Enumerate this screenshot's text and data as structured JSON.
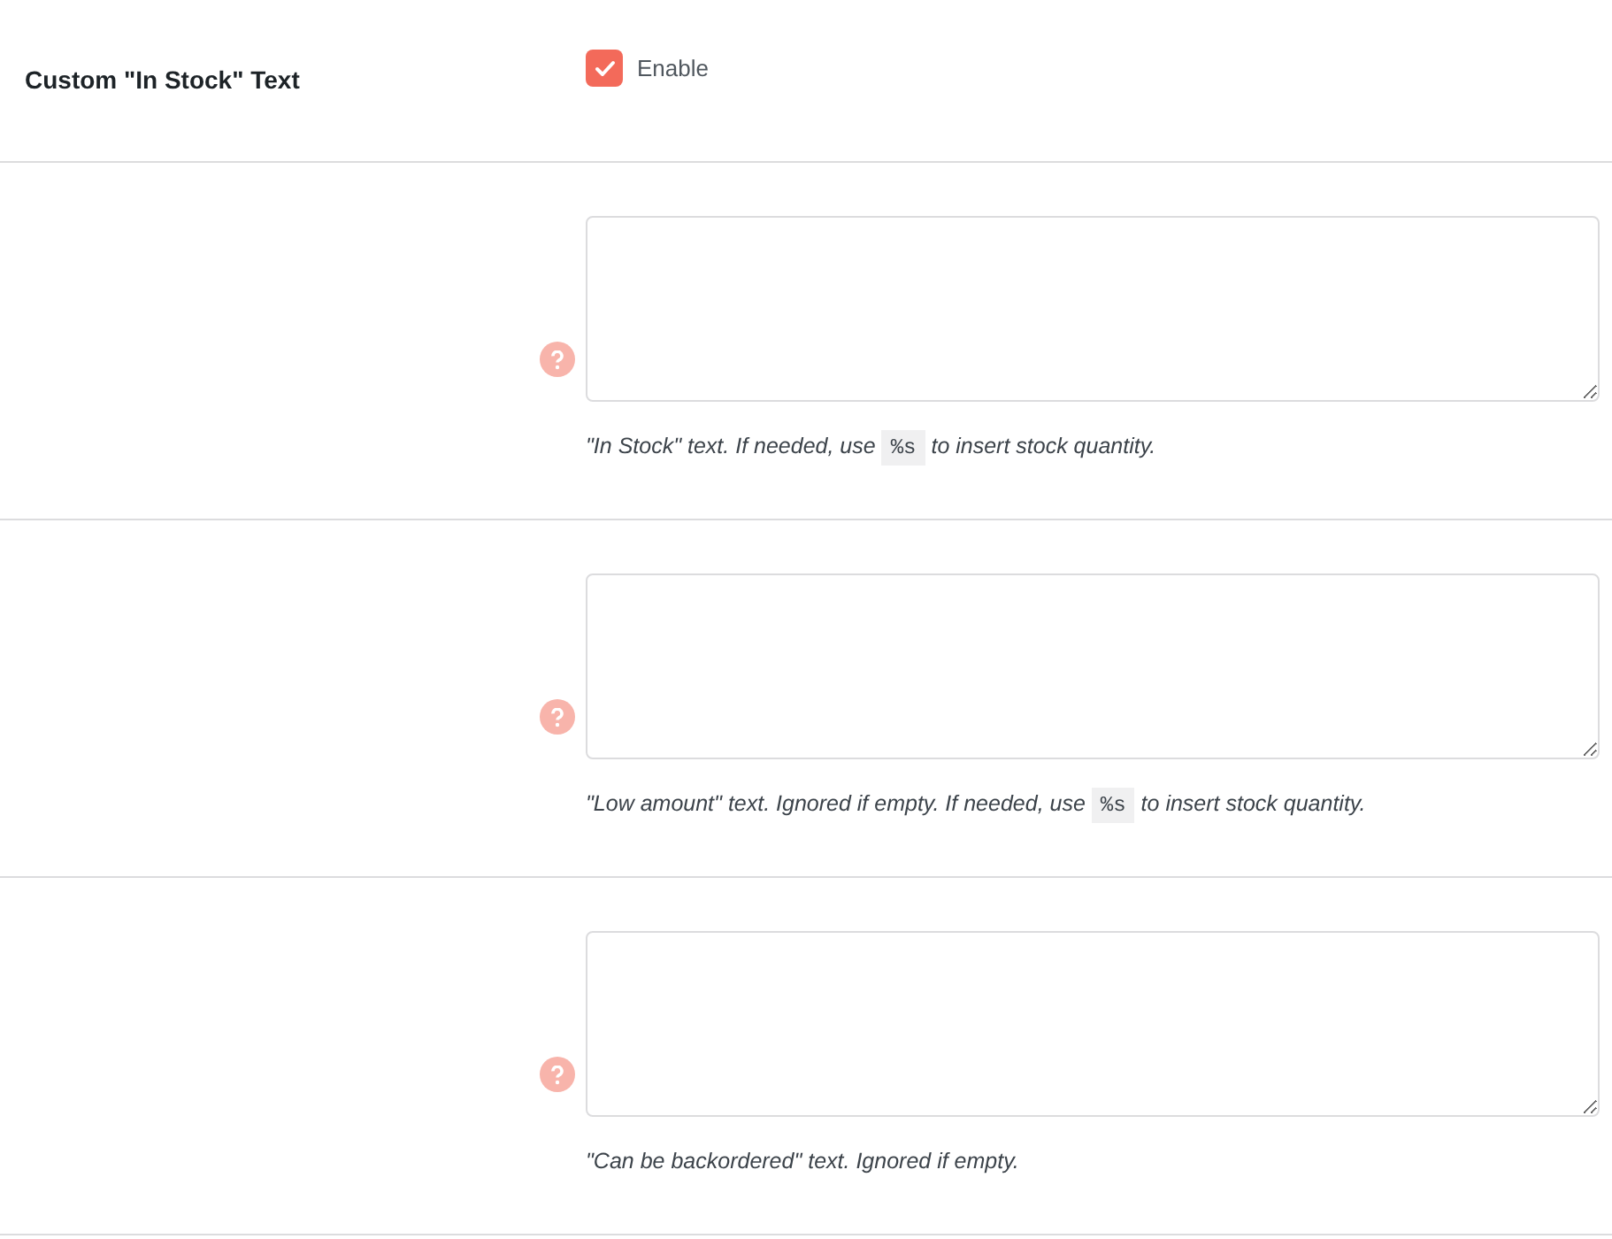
{
  "setting": {
    "label": "Custom \"In Stock\" Text",
    "checkbox": {
      "label": "Enable",
      "checked": true
    }
  },
  "fields": [
    {
      "description": {
        "before": "\"In Stock\" text. If needed, use",
        "code": "%s",
        "after": "to insert stock quantity."
      }
    },
    {
      "description": {
        "before": "\"Low amount\" text. Ignored if empty. If needed, use",
        "code": "%s",
        "after": "to insert stock quantity."
      }
    },
    {
      "description": {
        "before": "\"Can be backordered\" text. Ignored if empty."
      }
    }
  ]
}
